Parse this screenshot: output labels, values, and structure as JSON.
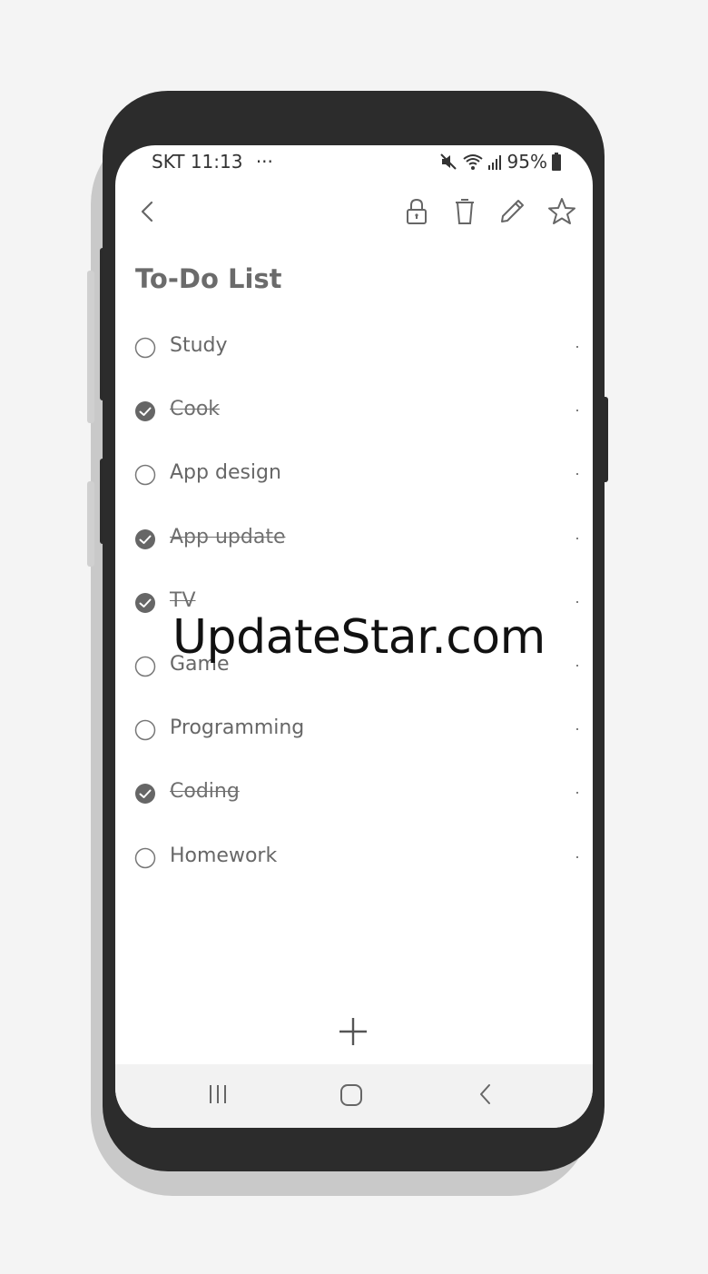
{
  "status_bar": {
    "carrier_time": "SKT 11:13",
    "more_indicator": "···",
    "battery": "95%"
  },
  "toolbar": {
    "back_icon": "chevron-left-icon",
    "actions": [
      "lock-icon",
      "trash-icon",
      "pencil-icon",
      "star-icon"
    ]
  },
  "note": {
    "title": "To-Do List",
    "items": [
      {
        "label": "Study",
        "checked": false
      },
      {
        "label": "Cook",
        "checked": true
      },
      {
        "label": "App design",
        "checked": false
      },
      {
        "label": "App update",
        "checked": true
      },
      {
        "label": "TV",
        "checked": true
      },
      {
        "label": "Game",
        "checked": false
      },
      {
        "label": "Programming",
        "checked": false
      },
      {
        "label": "Coding",
        "checked": true
      },
      {
        "label": "Homework",
        "checked": false
      }
    ]
  },
  "watermark": "UpdateStar.com",
  "nav_bar": [
    "recents-icon",
    "home-icon",
    "back-icon"
  ]
}
